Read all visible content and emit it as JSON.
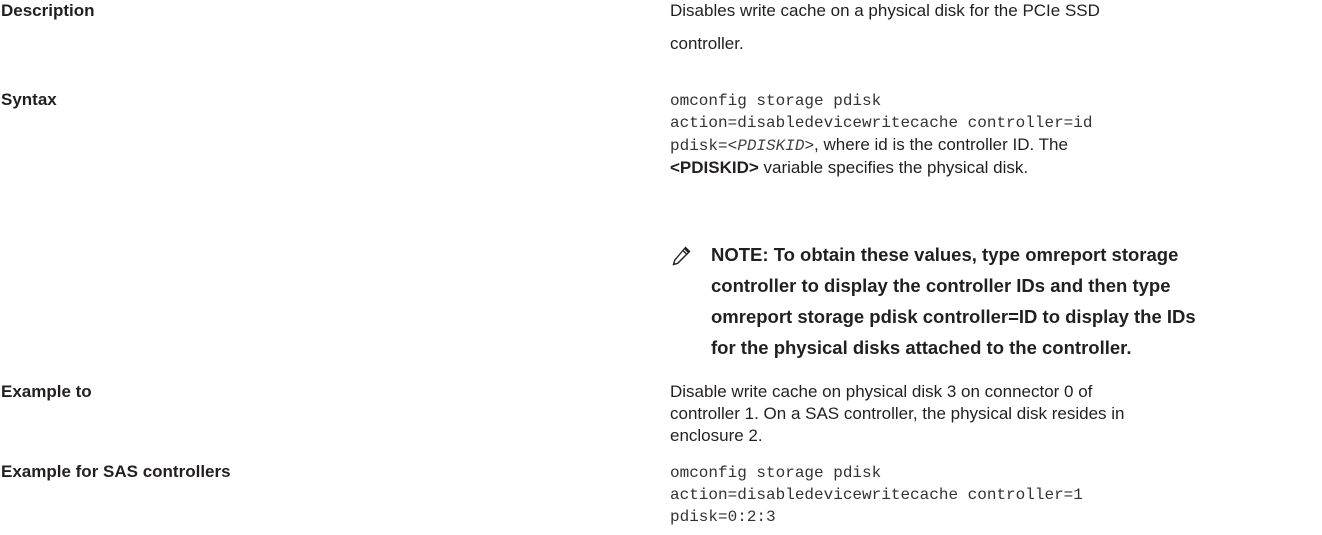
{
  "rows": {
    "description": {
      "label": "Description",
      "text_line1": "Disables write cache on a physical disk for the PCIe SSD",
      "text_line2": "controller."
    },
    "syntax": {
      "label": "Syntax",
      "code_line1": "omconfig storage pdisk",
      "code_line2": "action=disabledevicewritecache controller=id",
      "code_line3_prefix": "pdisk=<",
      "code_line3_var": "PDISKID",
      "code_line3_suffix": ">",
      "line3_tail": ", where id is the controller ID. The",
      "line4_bold": "<PDISKID>",
      "line4_tail": " variable specifies the physical disk."
    },
    "note": {
      "icon": "pencil-note-icon",
      "line1": "NOTE: To obtain these values, type omreport storage",
      "line2": "controller to display the controller IDs and then type",
      "line3": "omreport storage pdisk controller=ID to display the IDs",
      "line4": "for the physical disks attached to the controller."
    },
    "example_to": {
      "label": "Example to",
      "line1": "Disable write cache on physical disk 3 on connector 0 of",
      "line2": "controller 1. On a SAS controller, the physical disk resides in",
      "line3": "enclosure 2."
    },
    "example_sas": {
      "label": "Example for SAS controllers",
      "code_line1": "omconfig storage pdisk",
      "code_line2": "action=disabledevicewritecache controller=1",
      "code_line3": "pdisk=0:2:3"
    }
  }
}
